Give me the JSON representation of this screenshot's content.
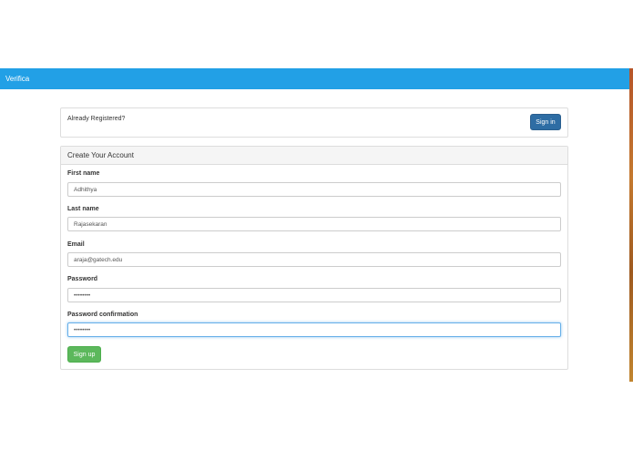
{
  "navbar": {
    "brand": "Verifica"
  },
  "login_prompt": {
    "question": "Already Registered?",
    "signin_label": "Sign in"
  },
  "form": {
    "heading": "Create Your Account",
    "fields": [
      {
        "label": "First name",
        "value": "Adhithya"
      },
      {
        "label": "Last name",
        "value": "Rajasekaran"
      },
      {
        "label": "Email",
        "value": "araja@gatech.edu"
      },
      {
        "label": "Password",
        "value": "••••••••"
      },
      {
        "label": "Password confirmation",
        "value": "••••••••"
      }
    ],
    "submit_label": "Sign up"
  },
  "colors": {
    "navbar": "#22a0e6",
    "signin_button": "#2e6da4",
    "signup_button": "#5cb85c",
    "focus_ring": "#66afe9"
  }
}
